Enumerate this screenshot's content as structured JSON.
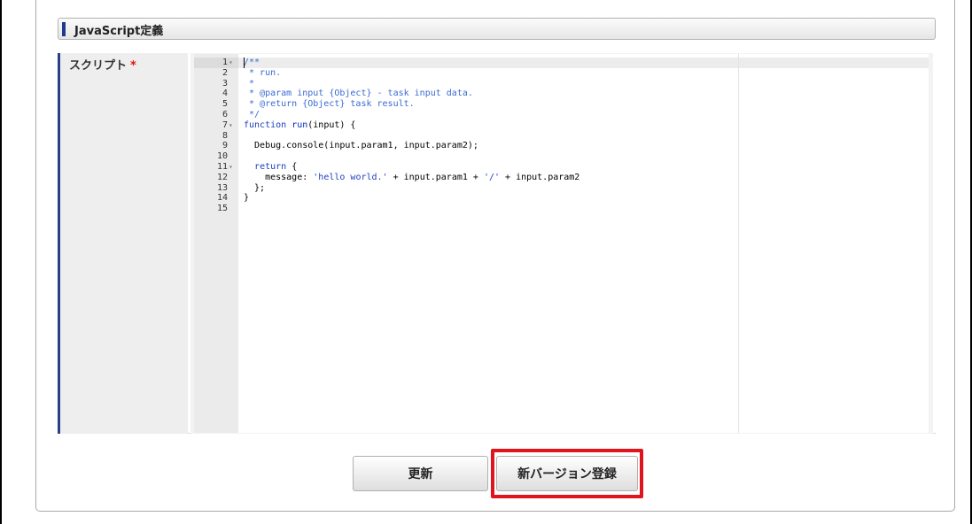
{
  "section": {
    "title": "JavaScript定義"
  },
  "field": {
    "label": "スクリプト",
    "required_mark": "*"
  },
  "editor": {
    "lines": [
      {
        "num": "1",
        "fold": true,
        "code": "/**"
      },
      {
        "num": "2",
        "fold": false,
        "code": " * run."
      },
      {
        "num": "3",
        "fold": false,
        "code": " *"
      },
      {
        "num": "4",
        "fold": false,
        "code": " * @param input {Object} - task input data."
      },
      {
        "num": "5",
        "fold": false,
        "code": " * @return {Object} task result."
      },
      {
        "num": "6",
        "fold": false,
        "code": " */"
      },
      {
        "num": "7",
        "fold": true,
        "code": "function run(input) {"
      },
      {
        "num": "8",
        "fold": false,
        "code": ""
      },
      {
        "num": "9",
        "fold": false,
        "code": "  Debug.console(input.param1, input.param2);"
      },
      {
        "num": "10",
        "fold": false,
        "code": ""
      },
      {
        "num": "11",
        "fold": true,
        "code": "  return {"
      },
      {
        "num": "12",
        "fold": false,
        "code": "    message: 'hello world.' + input.param1 + '/' + input.param2"
      },
      {
        "num": "13",
        "fold": false,
        "code": "  };"
      },
      {
        "num": "14",
        "fold": false,
        "code": "}"
      },
      {
        "num": "15",
        "fold": false,
        "code": ""
      }
    ]
  },
  "buttons": {
    "update": "更新",
    "new_version": "新バージョン登録"
  },
  "colors": {
    "highlight": "#e0141c",
    "label_bar": "#2b3f8c",
    "required": "#e01010"
  }
}
